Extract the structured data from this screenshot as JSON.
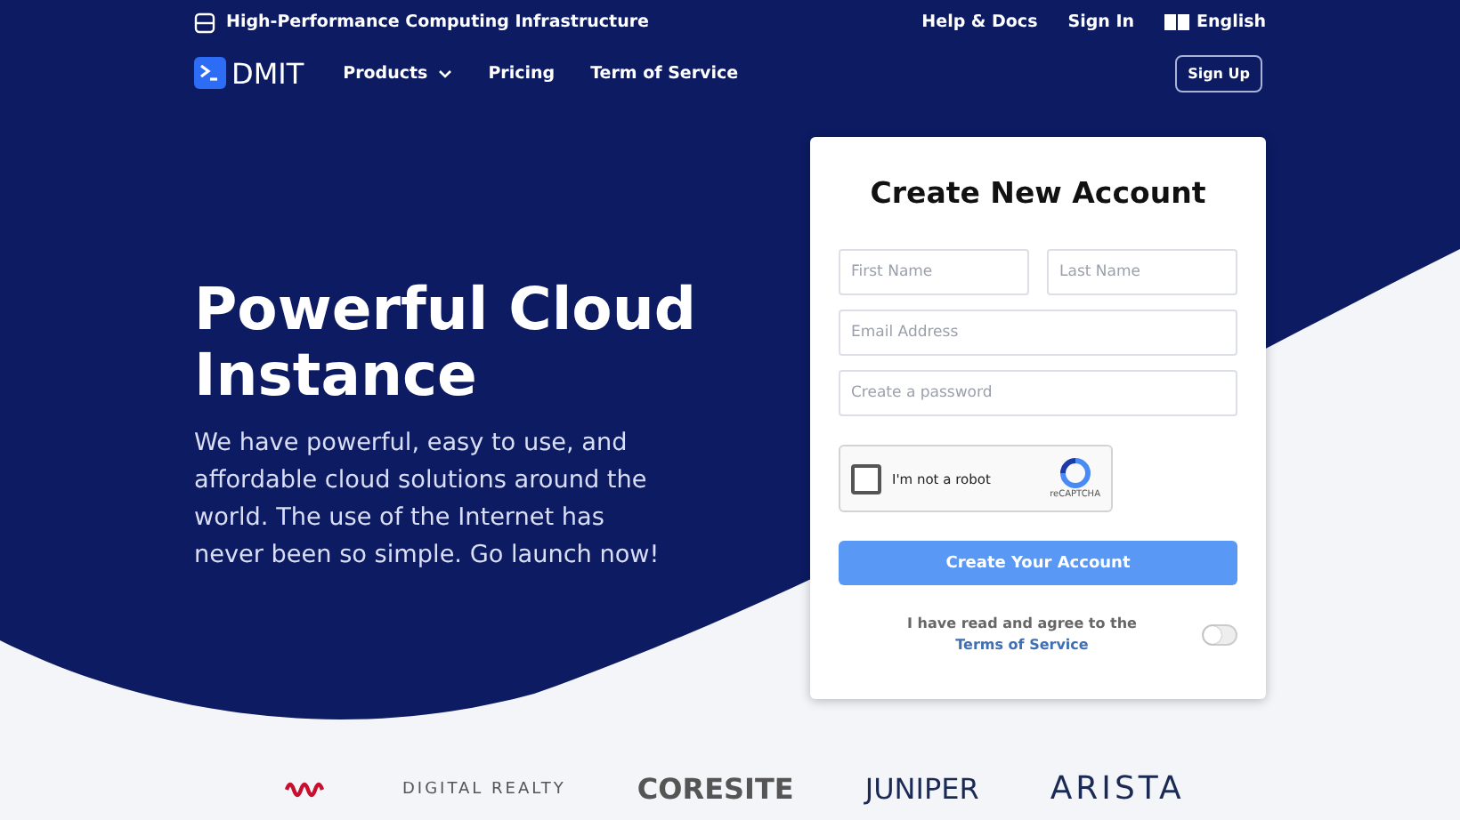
{
  "top_bar": {
    "tagline": "High-Performance Computing Infrastructure",
    "links": [
      "Help & Docs",
      "Sign In"
    ],
    "language": "English"
  },
  "nav": {
    "brand": "DMIT",
    "items": [
      {
        "label": "Products",
        "dropdown": true
      },
      {
        "label": "Pricing",
        "dropdown": false
      },
      {
        "label": "Term of Service",
        "dropdown": false
      }
    ],
    "signup": "Sign Up"
  },
  "hero": {
    "title": "Powerful Cloud Instance",
    "text": "We have powerful, easy to use, and affordable cloud solutions around the world. The use of the Internet has never been so simple. Go launch now!"
  },
  "form": {
    "title": "Create New Account",
    "fields": [
      {
        "placeholder": "First Name"
      },
      {
        "placeholder": "Last Name"
      },
      {
        "placeholder": "Email Address"
      },
      {
        "placeholder": "Create a password"
      }
    ],
    "captcha": {
      "label": "I'm not a robot",
      "brand": "reCAPTCHA",
      "checked": false
    },
    "submit": "Create Your Account",
    "agree_text": "I have read and agree to the",
    "agree_link": "Terms of Service",
    "agree_on": false
  },
  "partners": [
    "DIGITAL REALTY",
    "CORESITE",
    "JUNIPER",
    "ARISTA"
  ]
}
